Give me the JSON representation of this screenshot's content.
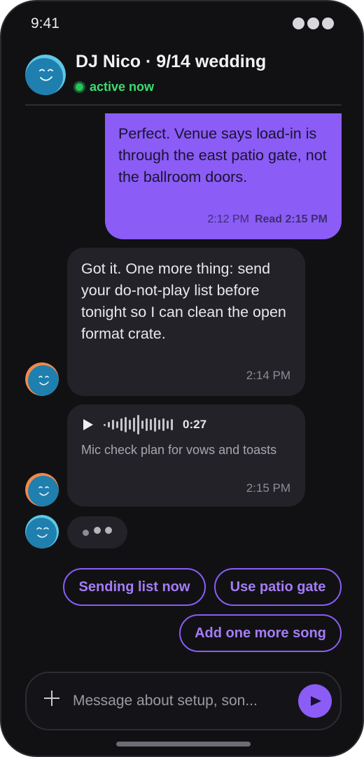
{
  "status_bar": {
    "time": "9:41"
  },
  "header": {
    "title": "DJ Nico · 9/14 wedding",
    "presence": "active now",
    "avatar_icon": "smiling-avatar-icon"
  },
  "messages": {
    "outgoing_1": {
      "text": "Perfect. Venue says load-in is through the east patio gate, not the ballroom doors.",
      "time": "2:12 PM",
      "read_receipt": "Read 2:15 PM"
    },
    "incoming_1": {
      "text": "Got it. One more thing: send your do-not-play list before tonight so I can clean the open format crate.",
      "time": "2:14 PM"
    },
    "voice_note": {
      "duration": "0:27",
      "caption": "Mic check plan for vows and toasts",
      "time": "2:15 PM"
    },
    "typing_indicator": true
  },
  "quick_replies": [
    "Sending list now",
    "Use patio gate",
    "Add one more song"
  ],
  "composer": {
    "placeholder": "Message about setup, son...",
    "value": ""
  },
  "colors": {
    "accent": "#8b5cf6",
    "background": "#111114",
    "bubble_incoming": "#222228",
    "presence": "#3ddc6f"
  }
}
